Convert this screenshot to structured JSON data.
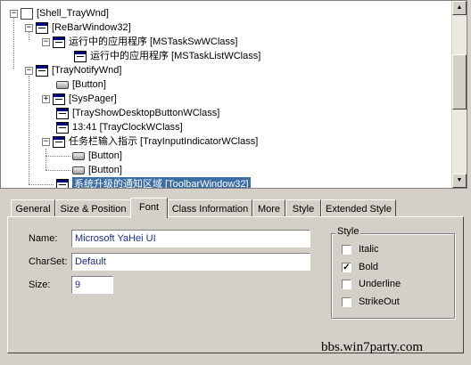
{
  "tree": {
    "nodes": [
      {
        "label": "[Shell_TrayWnd]",
        "expander": "−",
        "icon": "box-icon"
      },
      {
        "label": "[ReBarWindow32]",
        "expander": "−",
        "icon": "window-icon"
      },
      {
        "label": "运行中的应用程序 [MSTaskSwWClass]",
        "expander": "−",
        "icon": "window-icon"
      },
      {
        "label": "运行中的应用程序 [MSTaskListWClass]",
        "expander": "",
        "icon": "window-icon"
      },
      {
        "label": "[TrayNotifyWnd]",
        "expander": "−",
        "icon": "window-icon"
      },
      {
        "label": "[Button]",
        "expander": "",
        "icon": "button-icon"
      },
      {
        "label": "[SysPager]",
        "expander": "+",
        "icon": "window-icon"
      },
      {
        "label": "[TrayShowDesktopButtonWClass]",
        "expander": "",
        "icon": "window-icon"
      },
      {
        "label": "13:41 [TrayClockWClass]",
        "expander": "",
        "icon": "window-icon"
      },
      {
        "label": "任务栏输入指示 [TrayInputIndicatorWClass]",
        "expander": "−",
        "icon": "window-icon"
      },
      {
        "label": "[Button]",
        "expander": "",
        "icon": "button-icon"
      },
      {
        "label": "[Button]",
        "expander": "",
        "icon": "button-icon"
      },
      {
        "label": "系统升级的通知区域 [ToolbarWindow32]",
        "expander": "",
        "icon": "window-icon",
        "selected": true
      }
    ]
  },
  "tabs": [
    "General",
    "Size & Position",
    "Font",
    "Class Information",
    "More",
    "Style",
    "Extended Style"
  ],
  "active_tab": "Font",
  "font": {
    "name_label": "Name:",
    "name_value": "Microsoft YaHei UI",
    "charset_label": "CharSet:",
    "charset_value": "Default",
    "size_label": "Size:",
    "size_value": "9"
  },
  "style_group": {
    "title": "Style",
    "options": [
      {
        "label": "Italic",
        "checked": false
      },
      {
        "label": "Bold",
        "checked": true
      },
      {
        "label": "Underline",
        "checked": false
      },
      {
        "label": "StrikeOut",
        "checked": false
      }
    ]
  },
  "watermark": "bbs.win7party.com"
}
